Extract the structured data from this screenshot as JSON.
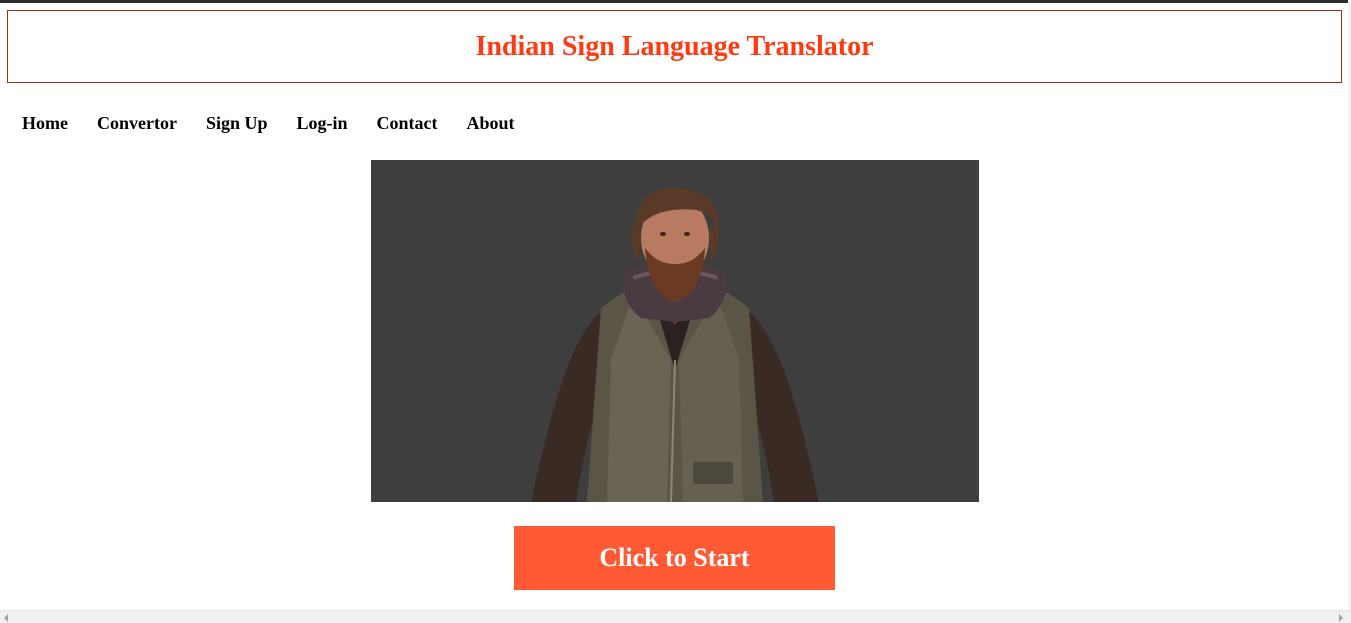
{
  "header": {
    "title": "Indian Sign Language Translator"
  },
  "nav": {
    "items": [
      {
        "label": "Home"
      },
      {
        "label": "Convertor"
      },
      {
        "label": "Sign Up"
      },
      {
        "label": "Log-in"
      },
      {
        "label": "Contact"
      },
      {
        "label": "About"
      }
    ]
  },
  "viewer": {
    "background_color": "#3e3e3e",
    "content": "3D avatar of a bearded man in a leather vest"
  },
  "actions": {
    "start_label": "Click to Start",
    "start_color": "#ff5a33"
  },
  "colors": {
    "title": "#ff3a12",
    "title_border": "#a0300f"
  }
}
